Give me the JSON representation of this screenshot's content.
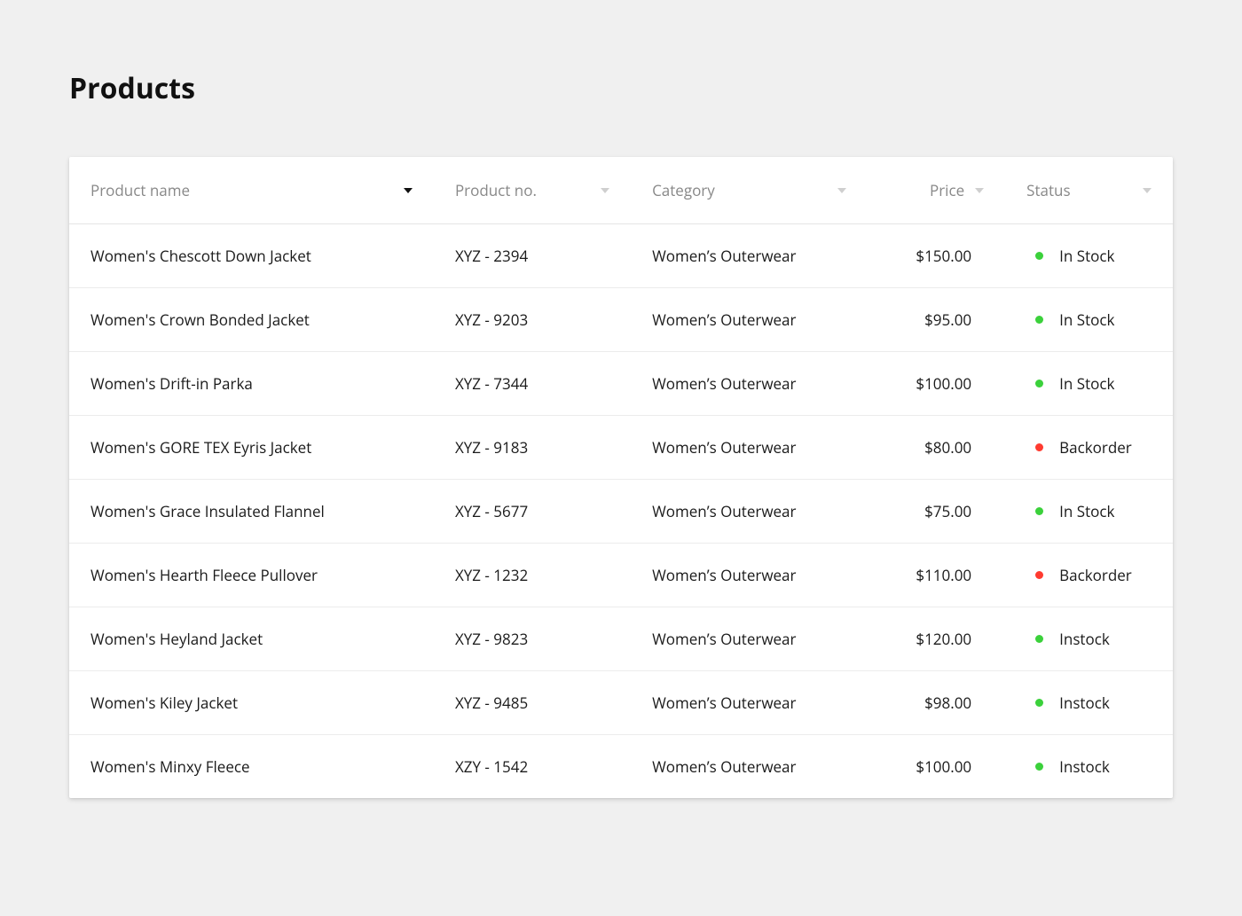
{
  "page": {
    "title": "Products"
  },
  "columns": {
    "name": "Product name",
    "no": "Product no.",
    "cat": "Category",
    "price": "Price",
    "status": "Status"
  },
  "status_colors": {
    "instock": "green",
    "backorder": "red"
  },
  "rows": [
    {
      "name": "Women's Chescott Down Jacket",
      "no": "XYZ - 2394",
      "cat": "Women’s Outerwear",
      "price": "$150.00",
      "status": "In Stock",
      "status_kind": "instock"
    },
    {
      "name": "Women's Crown Bonded Jacket",
      "no": "XYZ - 9203",
      "cat": "Women’s Outerwear",
      "price": "$95.00",
      "status": "In Stock",
      "status_kind": "instock"
    },
    {
      "name": "Women's Drift-in Parka",
      "no": "XYZ - 7344",
      "cat": "Women’s Outerwear",
      "price": "$100.00",
      "status": "In Stock",
      "status_kind": "instock"
    },
    {
      "name": "Women's GORE TEX Eyris Jacket",
      "no": "XYZ - 9183",
      "cat": "Women’s Outerwear",
      "price": "$80.00",
      "status": "Backorder",
      "status_kind": "backorder"
    },
    {
      "name": "Women's Grace Insulated Flannel",
      "no": "XYZ - 5677",
      "cat": "Women’s Outerwear",
      "price": "$75.00",
      "status": "In Stock",
      "status_kind": "instock"
    },
    {
      "name": "Women's  Hearth Fleece Pullover",
      "no": "XYZ - 1232",
      "cat": "Women’s Outerwear",
      "price": "$110.00",
      "status": "Backorder",
      "status_kind": "backorder"
    },
    {
      "name": "Women's Heyland Jacket",
      "no": "XYZ - 9823",
      "cat": "Women’s Outerwear",
      "price": "$120.00",
      "status": "Instock",
      "status_kind": "instock"
    },
    {
      "name": "Women's Kiley Jacket",
      "no": "XYZ - 9485",
      "cat": "Women’s Outerwear",
      "price": "$98.00",
      "status": "Instock",
      "status_kind": "instock"
    },
    {
      "name": "Women's Minxy Fleece",
      "no": "XZY - 1542",
      "cat": "Women’s Outerwear",
      "price": "$100.00",
      "status": "Instock",
      "status_kind": "instock"
    }
  ]
}
